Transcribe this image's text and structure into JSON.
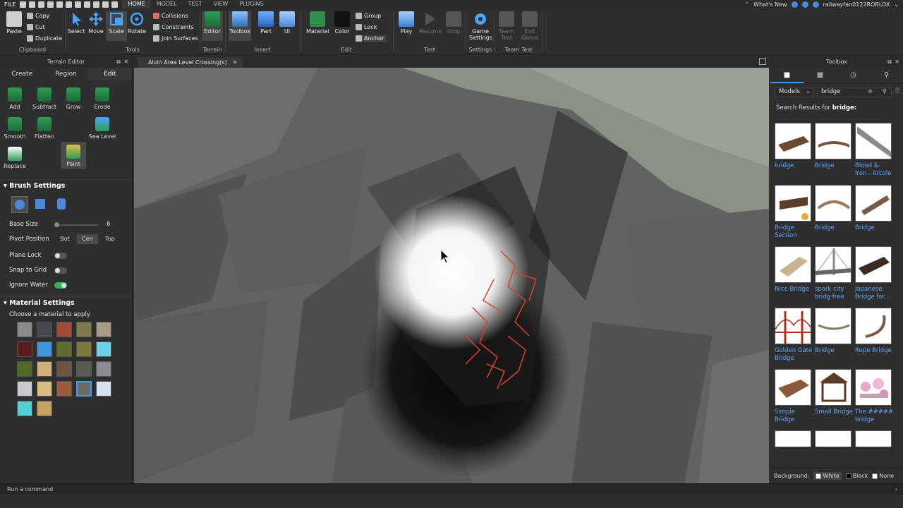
{
  "menubar": {
    "file": "FILE",
    "tabs": [
      "HOME",
      "MODEL",
      "TEST",
      "VIEW",
      "PLUGINS"
    ],
    "whats_new": "What's New",
    "username": "railwayfan0122ROBLOX"
  },
  "ribbon": {
    "clipboard": {
      "paste": "Paste",
      "copy": "Copy",
      "cut": "Cut",
      "duplicate": "Duplicate",
      "label": "Clipboard"
    },
    "tools": {
      "select": "Select",
      "move": "Move",
      "scale": "Scale",
      "rotate": "Rotate",
      "collisions": "Collisions",
      "constraints": "Constraints",
      "join_surfaces": "Join Surfaces",
      "label": "Tools"
    },
    "terrain": {
      "editor": "Editor",
      "label": "Terrain"
    },
    "insert": {
      "toolbox": "Toolbox",
      "part": "Part",
      "ui": "UI",
      "label": "Insert"
    },
    "edit": {
      "material": "Material",
      "color": "Color",
      "group": "Group",
      "lock": "Lock",
      "anchor": "Anchor",
      "label": "Edit"
    },
    "test": {
      "play": "Play",
      "resume": "Resume",
      "stop": "Stop",
      "label": "Test"
    },
    "settings": {
      "game_settings_1": "Game",
      "game_settings_2": "Settings",
      "label": "Settings"
    },
    "team_test": {
      "team_test_1": "Team",
      "team_test_2": "Test",
      "exit_game_1": "Exit",
      "exit_game_2": "Game",
      "label": "Team Test"
    }
  },
  "terrain_editor": {
    "title": "Terrain Editor",
    "tabs": [
      "Create",
      "Region",
      "Edit"
    ],
    "tools": [
      "Add",
      "Subtract",
      "Grow",
      "Erode",
      "Smooth",
      "Flatten",
      "Paint",
      "Sea Level",
      "Replace"
    ],
    "brush_settings": "Brush Settings",
    "base_size_label": "Base Size",
    "base_size_value": "6",
    "pivot_label": "Pivot Position",
    "pivot_options": [
      "Bot",
      "Cen",
      "Top"
    ],
    "plane_lock": "Plane Lock",
    "snap_to_grid": "Snap to Grid",
    "ignore_water": "Ignore Water",
    "material_settings": "Material Settings",
    "choose_material": "Choose a material to apply"
  },
  "document": {
    "tab_title": "Alvin Area Level Crossing(s)"
  },
  "toolbox": {
    "title": "Toolbox",
    "category": "Models",
    "search_value": "bridge",
    "results_prefix": "Search Results for ",
    "results_query": "bridge:",
    "items": [
      [
        "bridge"
      ],
      [
        "Bridge"
      ],
      [
        "Blood &",
        "Iron - Arcole"
      ],
      [
        "Bridge",
        "Section"
      ],
      [
        "Bridge"
      ],
      [
        "Bridge"
      ],
      [
        "Nice Bridge"
      ],
      [
        "spark city",
        "bridg free"
      ],
      [
        "Japanese",
        "Bridge for..."
      ],
      [
        "Golden Gate",
        "Bridge"
      ],
      [
        "Bridge"
      ],
      [
        "Rope Bridge"
      ],
      [
        "Simple",
        "Bridge"
      ],
      [
        "Small Bridge"
      ],
      [
        "The #####",
        "bridge"
      ]
    ],
    "background_label": "Background:",
    "background_options": [
      "White",
      "Black",
      "None"
    ]
  },
  "command_bar": {
    "placeholder": "Run a command"
  },
  "colors": {
    "accent_blue": "#3b9cff",
    "link_blue": "#5fa8ff",
    "toggle_green": "#3dae56"
  }
}
